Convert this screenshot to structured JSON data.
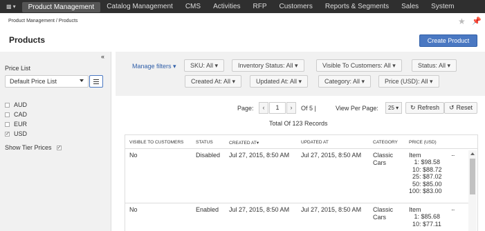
{
  "nav": {
    "items": [
      "Product Management",
      "Catalog Management",
      "CMS",
      "Activities",
      "RFP",
      "Customers",
      "Reports & Segments",
      "Sales",
      "System"
    ]
  },
  "breadcrumb": "Product Management / Products",
  "page_title": "Products",
  "create_label": "Create Product",
  "sidebar": {
    "price_list_label": "Price List",
    "price_list_value": "Default Price List",
    "currencies": [
      {
        "code": "AUD",
        "checked": false
      },
      {
        "code": "CAD",
        "checked": false
      },
      {
        "code": "EUR",
        "checked": false
      },
      {
        "code": "USD",
        "checked": true
      }
    ],
    "tier_label": "Show Tier Prices",
    "tier_checked": true
  },
  "filters": {
    "manage_label": "Manage filters",
    "row1": [
      "SKU: All",
      "Inventory Status: All",
      "Visible To Customers: All",
      "Status: All"
    ],
    "row2": [
      "Created At: All",
      "Updated At: All",
      "Category: All",
      "Price (USD): All"
    ]
  },
  "pager": {
    "page_label": "Page:",
    "page_value": "1",
    "of_label": "Of 5 |",
    "per_page_label": "View Per Page:",
    "per_page_value": "25",
    "refresh_label": "Refresh",
    "reset_label": "Reset",
    "total": "Total Of 123 Records"
  },
  "table": {
    "columns": [
      "Visible to Customers",
      "Status",
      "Created At",
      "Updated At",
      "Category",
      "Price (USD)"
    ],
    "rows": [
      {
        "visible": "No",
        "status": "Disabled",
        "created": "Jul 27, 2015, 8:50 AM",
        "updated": "Jul 27, 2015, 8:50 AM",
        "category1": "Classic",
        "category2": "Cars",
        "price_lines": [
          "Item",
          "   1: $98.58",
          "  10: $88.72",
          "  25: $87.02",
          "  50: $85.00",
          "100: $83.00"
        ]
      },
      {
        "visible": "No",
        "status": "Enabled",
        "created": "Jul 27, 2015, 8:50 AM",
        "updated": "Jul 27, 2015, 8:50 AM",
        "category1": "Classic",
        "category2": "Cars",
        "price_lines": [
          "Item",
          "   1: $85.68",
          "  10: $77.11"
        ]
      }
    ]
  }
}
